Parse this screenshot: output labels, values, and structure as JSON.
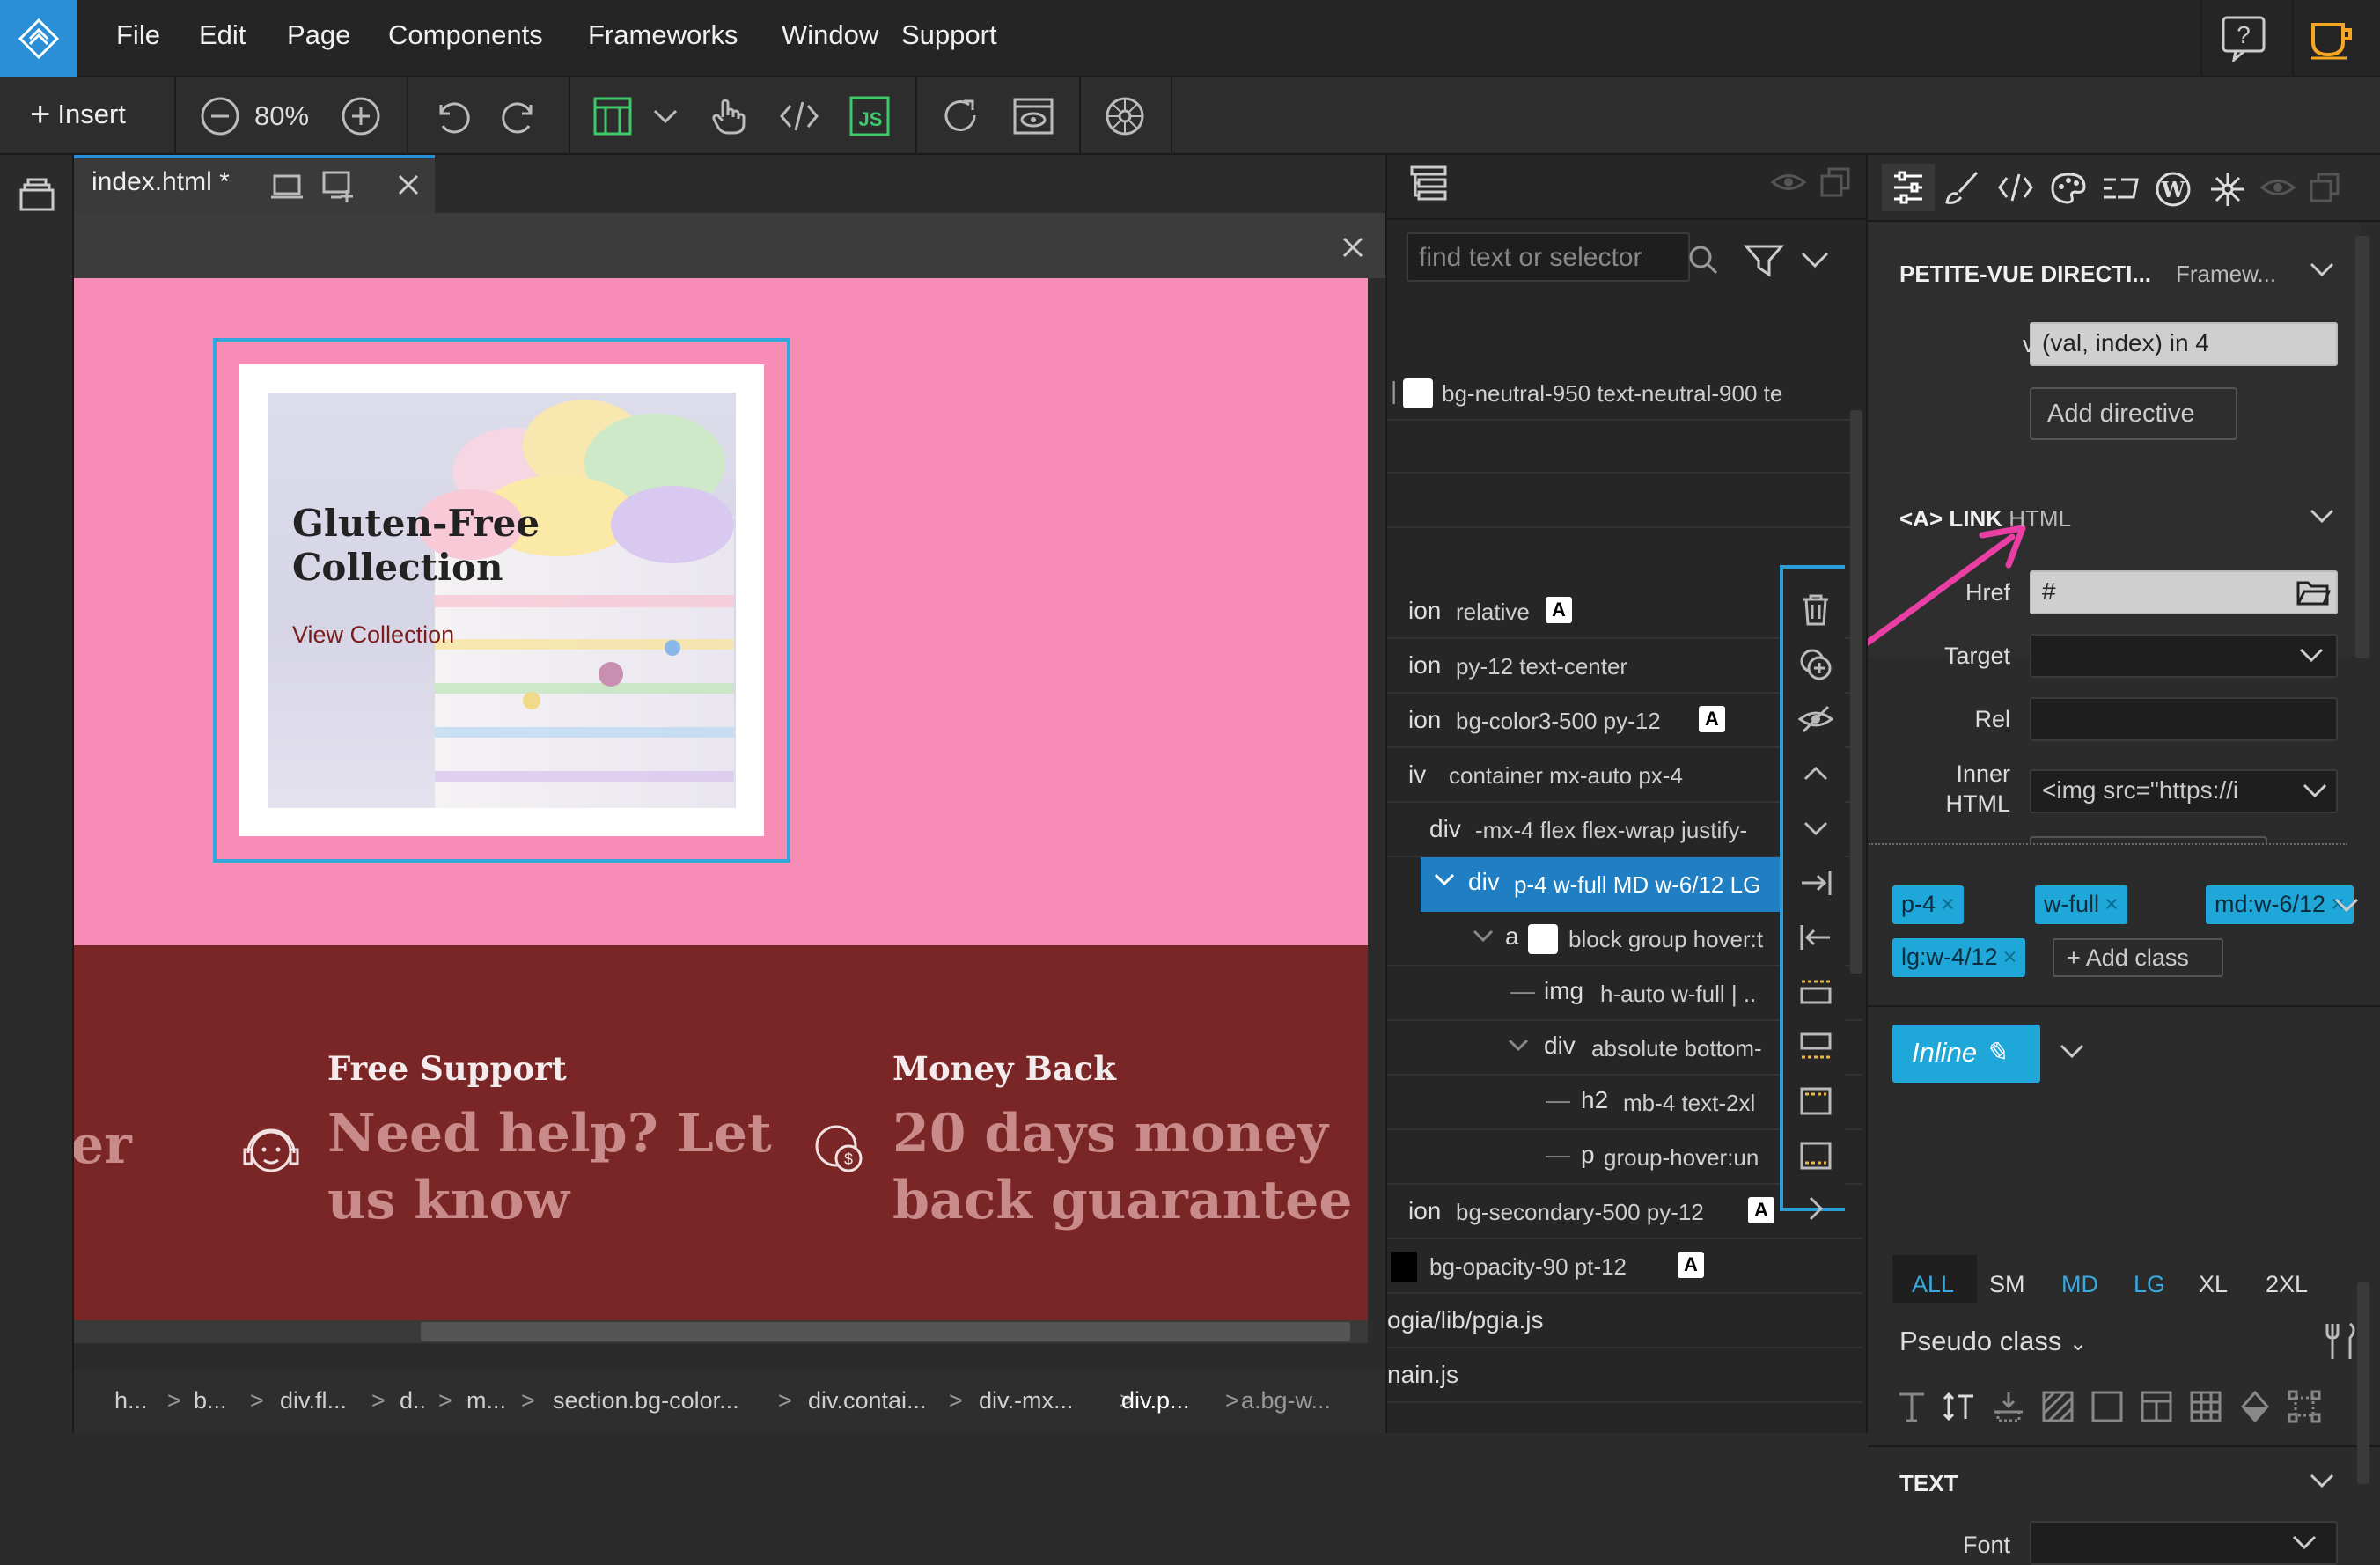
{
  "menu": [
    "File",
    "Edit",
    "Page",
    "Components",
    "Frameworks",
    "Window",
    "Support"
  ],
  "toolbar": {
    "insert_label": "Insert",
    "zoom": "80%"
  },
  "tab": {
    "name": "index.html *"
  },
  "canvas": {
    "card_title_line1": "Gluten-Free",
    "card_title_line2": "Collection",
    "card_link": "View Collection",
    "feature_partial": "er",
    "support_title": "Free Support",
    "support_text_line1": "Need help? Let",
    "support_text_line2": "us know",
    "money_title": "Money Back",
    "money_text_line1": "20 days money",
    "money_text_line2": "back guarantee"
  },
  "breadcrumb": [
    "h...",
    "b...",
    "div.fl...",
    "d..",
    "m...",
    "section.bg-color...",
    "div.contai...",
    "div.-mx...",
    "div.p...",
    "a.bg-w..."
  ],
  "navigator": {
    "search_placeholder": "find text or selector",
    "rows": [
      {
        "tag": "",
        "cls": "bg-neutral-950 text-neutral-900 te",
        "badge": ""
      },
      {
        "tag": "ion",
        "cls": "relative",
        "badge": "A"
      },
      {
        "tag": "ion",
        "cls": "py-12 text-center",
        "badge": ""
      },
      {
        "tag": "ion",
        "cls": "bg-color3-500 py-12",
        "badge": "A"
      },
      {
        "tag": "iv",
        "cls": "container mx-auto px-4",
        "badge": ""
      },
      {
        "tag": "div",
        "cls": "-mx-4 flex flex-wrap justify-",
        "badge": ""
      },
      {
        "tag": "div",
        "cls": "p-4 w-full MD w-6/12 LG",
        "badge": ""
      },
      {
        "tag": "a",
        "cls": "block group hover:t",
        "badge": ""
      },
      {
        "tag": "img",
        "cls": "h-auto w-full | ..",
        "badge": ""
      },
      {
        "tag": "div",
        "cls": "absolute bottom-",
        "badge": ""
      },
      {
        "tag": "h2",
        "cls": "mb-4 text-2xl",
        "badge": ""
      },
      {
        "tag": "p",
        "cls": "group-hover:un",
        "badge": ""
      },
      {
        "tag": "ion",
        "cls": "bg-secondary-500 py-12",
        "badge": "A"
      },
      {
        "tag": "",
        "cls": "bg-opacity-90 pt-12",
        "badge": "A"
      },
      {
        "tag": "ogia/lib/pgia.js",
        "cls": "",
        "badge": ""
      },
      {
        "tag": "nain.js",
        "cls": "",
        "badge": ""
      }
    ]
  },
  "props": {
    "directive_section": "PETITE-VUE DIRECTI...",
    "directive_framework": "Framew...",
    "vfor_label": "v-for",
    "vfor_value": "(val, index) in 4",
    "add_directive": "Add directive",
    "link_section": "<A> LINK",
    "link_section_sub": "HTML",
    "href_label": "Href",
    "href_value": "#",
    "target_label": "Target",
    "rel_label": "Rel",
    "inner_label_1": "Inner",
    "inner_label_2": "HTML",
    "inner_value": "<img src=\"https://i",
    "classes": [
      "p-4",
      "w-full",
      "md:w-6/12",
      "lg:w-4/12"
    ],
    "add_class": "Add class",
    "inline_label": "Inline",
    "breakpoints": [
      "ALL",
      "SM",
      "MD",
      "LG",
      "XL",
      "2XL"
    ],
    "pseudo_class": "Pseudo class",
    "text_section": "TEXT",
    "font_label": "Font"
  },
  "colors": {
    "accent": "#2a9cd8",
    "pink": "#f78db7",
    "maroon": "#7a2626",
    "arrow": "#e93fa5"
  }
}
